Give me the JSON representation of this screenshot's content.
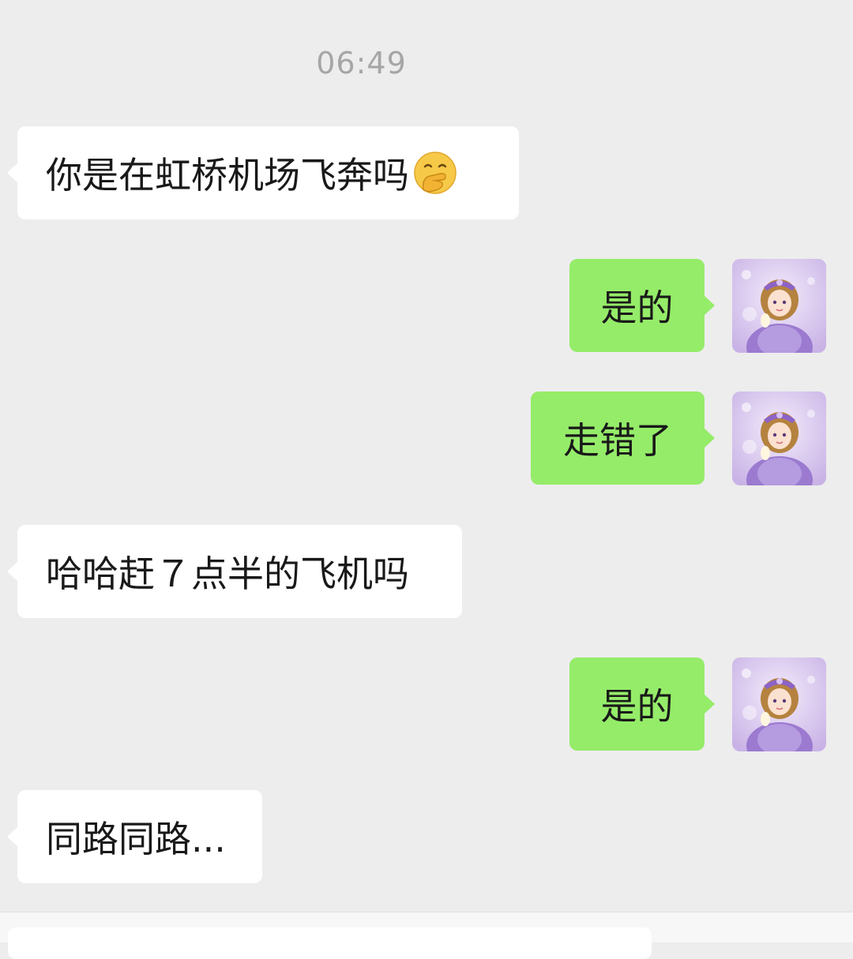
{
  "chat": {
    "timestamp": "06:49",
    "messages": [
      {
        "side": "in",
        "text": "你是在虹桥机场飞奔吗",
        "emoji": "hand-over-mouth-emoji"
      },
      {
        "side": "out",
        "text": "是的"
      },
      {
        "side": "out",
        "text": "走错了"
      },
      {
        "side": "in",
        "text": "哈哈赶７点半的飞机吗"
      },
      {
        "side": "out",
        "text": "是的"
      },
      {
        "side": "in",
        "text": "同路同路..."
      }
    ]
  },
  "colors": {
    "background": "#ededed",
    "incoming_bubble": "#ffffff",
    "outgoing_bubble": "#95ec69",
    "timestamp_text": "#a6a6a6",
    "message_text": "#191919"
  }
}
